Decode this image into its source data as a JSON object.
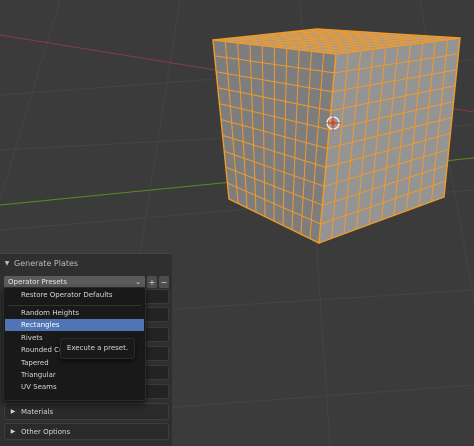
{
  "panel": {
    "title": "Generate Plates",
    "presets_label": "Operator Presets",
    "add_symbol": "+",
    "remove_symbol": "−"
  },
  "menu": {
    "items": [
      "Restore Operator Defaults",
      "Random Heights",
      "Rectangles",
      "Rivets",
      "Rounded Cor",
      "Tapered",
      "Triangular",
      "UV Seams"
    ],
    "active_item": "Rectangles"
  },
  "tooltip": "Execute a preset.",
  "subpanels": {
    "materials": "Materials",
    "other_options": "Other Options"
  },
  "icons": {
    "panel_toggle": "expand-triangle-icon",
    "dropdown": "chevron-down-icon",
    "collapsed": "collapsed-triangle-icon",
    "origin": "object-origin-icon"
  },
  "colors": {
    "selection_outline": "#f09a2a",
    "cube_face": "#8a8a8a",
    "highlight": "#5175b4",
    "x_axis": "#8a3b45",
    "y_axis": "#5d8a27"
  }
}
